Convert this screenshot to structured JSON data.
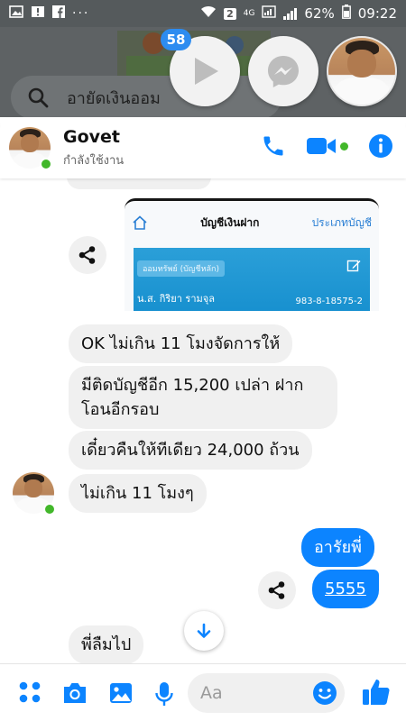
{
  "status_bar": {
    "sim": "2",
    "network": "4G",
    "battery": "62%",
    "time": "09:22",
    "left_icons": [
      "image-icon",
      "alert-icon",
      "facebook-icon",
      "more-icon"
    ]
  },
  "background": {
    "search_text": "อายัดเงินออม"
  },
  "chat_heads": {
    "video_badge": "58"
  },
  "header": {
    "name": "Govet",
    "status": "กำลังใช้งาน"
  },
  "bank_card": {
    "title": "บัญชีเงินฝาก",
    "type_link": "ประเภทบัญชี",
    "account_tag": "ออมทรัพย์ (บัญชีหลัก)",
    "holder": "น.ส. กิริยา รามจุล",
    "account_number": "983-8-18575-2"
  },
  "messages": [
    {
      "from": "them",
      "text": "OK ไม่เกิน 11 โมงจัดการให้"
    },
    {
      "from": "them",
      "text": "มีติดบัญชีอีก 15,200 เปล่า ฝาก\nโอนอีกรอบ"
    },
    {
      "from": "them",
      "text": "เดี๋ยวคืนให้ทีเดียว 24,000 ถ้วน"
    },
    {
      "from": "them",
      "text": "ไม่เกิน 11 โมงๆ"
    },
    {
      "from": "me",
      "text": "อารัยพี่"
    },
    {
      "from": "me",
      "text": "5555"
    },
    {
      "from": "them",
      "text": "พี่ลืมไป"
    }
  ],
  "composer": {
    "placeholder": "Aa"
  },
  "colors": {
    "messenger_blue": "#0c84ff",
    "online_green": "#42b72a",
    "status_bar": "#555a5c"
  }
}
